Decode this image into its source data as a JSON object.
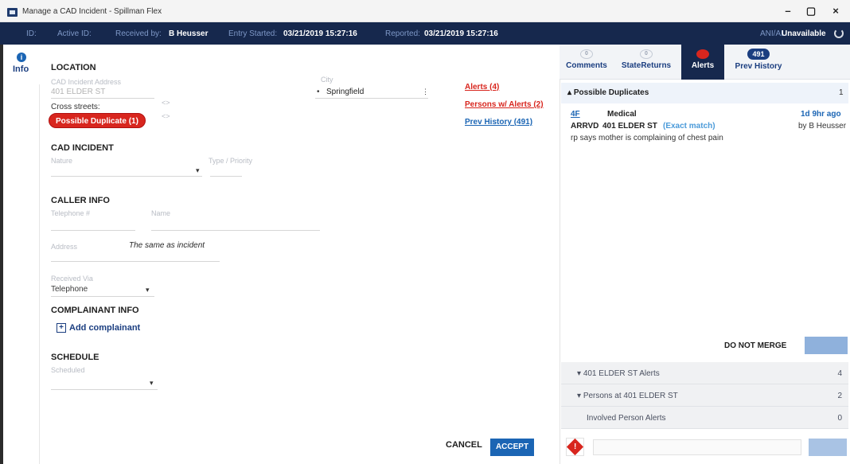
{
  "window": {
    "title": "Manage a CAD Incident - Spillman Flex",
    "minimize": "–",
    "maximize": "▢",
    "close": "×"
  },
  "header": {
    "id_label": "ID:",
    "active_id_label": "Active ID:",
    "received_by_label": "Received by:",
    "received_by_value": "B Heusser",
    "entry_started_label": "Entry Started:",
    "entry_started_value": "03/21/2019 15:27:16",
    "reported_label": "Reported:",
    "reported_value": "03/21/2019 15:27:16",
    "ani_ali_label": "ANI/ALI:",
    "ani_ali_value": "Unavailable"
  },
  "rail": {
    "info_label": "Info",
    "info_icon": "info-icon"
  },
  "location": {
    "section_title": "LOCATION",
    "address_label": "CAD Incident Address",
    "address_value": "401 ELDER ST",
    "city_label": "City",
    "city_value": "Springfield",
    "cross_streets_label": "Cross streets:",
    "possible_duplicate": "Possible Duplicate (1)",
    "alerts_link": "Alerts (4)",
    "persons_alerts_link": "Persons w/ Alerts (2)",
    "prev_history_link": "Prev History (491)"
  },
  "cad_incident": {
    "section_title": "CAD INCIDENT",
    "nature_label": "Nature",
    "type_priority_label": "Type / Priority"
  },
  "caller_info": {
    "section_title": "CALLER INFO",
    "telephone_label": "Telephone #",
    "name_label": "Name",
    "address_label": "Address",
    "same_as_incident": "The same as incident",
    "received_via_label": "Received Via",
    "received_via_value": "Telephone"
  },
  "complainant": {
    "section_title": "COMPLAINANT INFO",
    "add_label": "Add complainant"
  },
  "schedule": {
    "section_title": "SCHEDULE",
    "field_label": "Scheduled"
  },
  "actions": {
    "cancel": "CANCEL",
    "accept": "ACCEPT"
  },
  "right_panel": {
    "tabs": [
      {
        "label": "Comments",
        "icon": "comments-icon",
        "badge": ""
      },
      {
        "label": "StateReturns",
        "icon": "state-returns-icon",
        "badge": ""
      },
      {
        "label": "Alerts",
        "icon": "alerts-icon",
        "badge": ""
      },
      {
        "label": "Prev History",
        "icon": "history-icon",
        "badge": "491"
      }
    ],
    "duplicates_title": "Possible Duplicates",
    "duplicates_count": "1",
    "duplicate": {
      "unit": "4F",
      "nature": "Medical",
      "status": "ARRVD",
      "address": "401 ELDER ST",
      "match": "(Exact match)",
      "time_ago": "1d 9hr ago",
      "by": "by B Heusser",
      "comment": "rp says mother is complaining of chest pain"
    },
    "do_not_merge": "DO NOT MERGE",
    "accordion": [
      {
        "label": "401 ELDER ST Alerts",
        "count": "4"
      },
      {
        "label": "Persons at 401 ELDER ST",
        "count": "2"
      },
      {
        "label": "Involved Person Alerts",
        "count": "0"
      }
    ]
  },
  "colors": {
    "header_bg": "#16284d",
    "accent_blue": "#1b65b4",
    "alert_red": "#d8261e"
  }
}
